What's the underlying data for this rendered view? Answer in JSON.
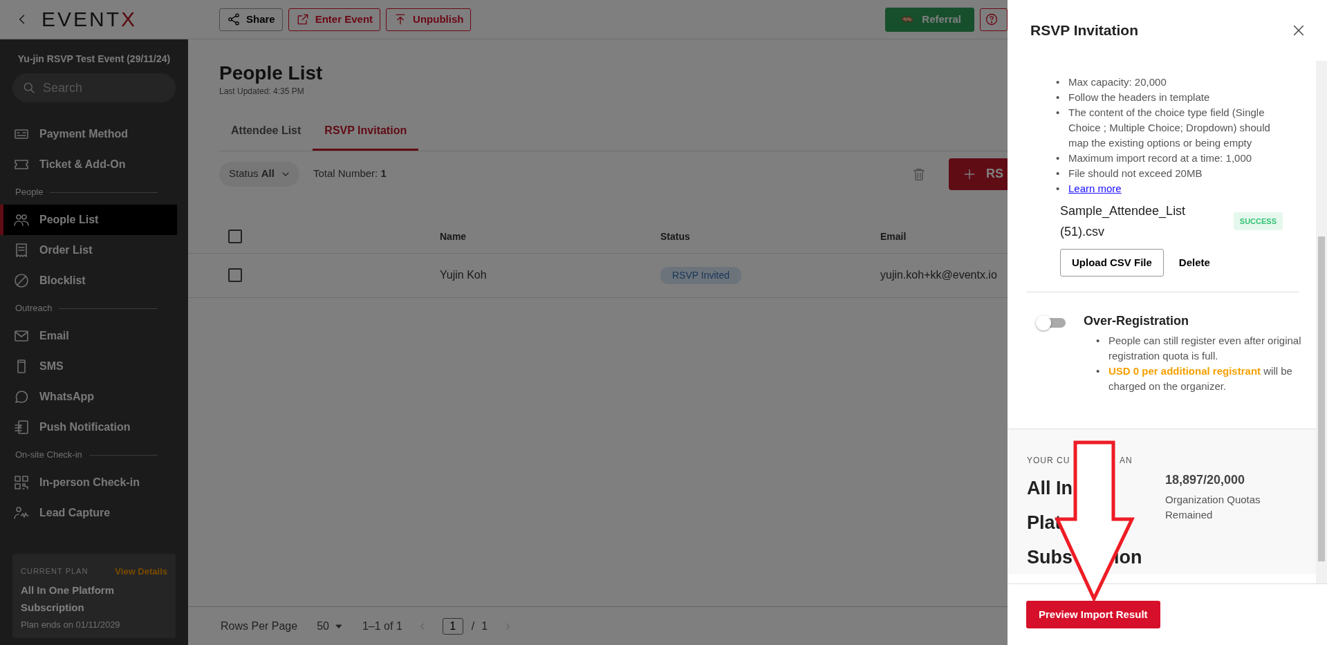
{
  "topbar": {
    "logo": "EVENTX",
    "buttons": [
      {
        "kind": "share",
        "label": "Share"
      },
      {
        "kind": "enter",
        "label": "Enter Event"
      },
      {
        "kind": "unpublish",
        "label": "Unpublish"
      },
      {
        "kind": "referral",
        "label": "Referral"
      },
      {
        "kind": "help"
      }
    ]
  },
  "sidebar": {
    "event_title": "Yu-jin RSVP Test Event (29/11/24)",
    "search_placeholder": "Search",
    "items": [
      {
        "kind": "item",
        "label": "Payment Method",
        "selected": false
      },
      {
        "kind": "item",
        "label": "Ticket & Add-On",
        "selected": false
      },
      {
        "kind": "section",
        "label": "People"
      },
      {
        "kind": "item",
        "label": "People List",
        "selected": true
      },
      {
        "kind": "item",
        "label": "Order List",
        "selected": false
      },
      {
        "kind": "item",
        "label": "Blocklist",
        "selected": false
      },
      {
        "kind": "section",
        "label": "Outreach"
      },
      {
        "kind": "item",
        "label": "Email",
        "selected": false
      },
      {
        "kind": "item",
        "label": "SMS",
        "selected": false
      },
      {
        "kind": "item",
        "label": "WhatsApp",
        "selected": false
      },
      {
        "kind": "item",
        "label": "Push Notification",
        "selected": false
      },
      {
        "kind": "section",
        "label": "On-site Check-in"
      },
      {
        "kind": "item",
        "label": "In-person Check-in",
        "selected": false
      },
      {
        "kind": "item",
        "label": "Lead Capture",
        "selected": false
      }
    ],
    "plan": {
      "label": "CURRENT PLAN",
      "link": "View Details",
      "name": "All In One Platform Subscription",
      "ends": "Plan ends on 01/11/2029"
    }
  },
  "page": {
    "title": "People List",
    "last_updated": "Last Updated: 4:35 PM",
    "tabs": [
      {
        "label": "Attendee List",
        "selected": false
      },
      {
        "label": "RSVP Invitation",
        "selected": true
      }
    ],
    "filter": {
      "label": "Status",
      "value": "All"
    },
    "total": {
      "label": "Total Number:",
      "value": "1"
    },
    "add_button": "RS",
    "table": {
      "header_checked": false,
      "columns": [
        "Name",
        "Status",
        "Email"
      ],
      "rows": [
        {
          "checked": false,
          "name": "Yujin Koh",
          "status": "RSVP Invited",
          "email": "yujin.koh+kk@eventx.io"
        }
      ]
    },
    "pagination": {
      "rows_label": "Rows Per Page",
      "rows_value": "50",
      "range": "1–1 of 1",
      "page": "1",
      "separator": "/",
      "pages": "1"
    }
  },
  "drawer": {
    "title": "RSVP Invitation",
    "rules": [
      {
        "kind": "text",
        "bullet": "•",
        "text": "Max capacity: 20,000"
      },
      {
        "kind": "text",
        "bullet": "•",
        "text": "Follow the headers in template"
      },
      {
        "kind": "text",
        "bullet": "•",
        "text": "The content of the choice type field (Single Choice ; Multiple Choice; Dropdown) should map the existing options or being empty"
      },
      {
        "kind": "text",
        "bullet": "•",
        "text": "Maximum import record at a time: 1,000"
      },
      {
        "kind": "text",
        "bullet": "•",
        "text": "File should not exceed 20MB"
      },
      {
        "kind": "link",
        "bullet": "•",
        "text": "Learn more"
      }
    ],
    "file": {
      "name": "Sample_Attendee_List (51).csv",
      "status": "SUCCESS"
    },
    "file_buttons": [
      "Upload CSV File",
      "Delete"
    ],
    "over_registration": {
      "title": "Over-Registration",
      "on": false,
      "notes": [
        {
          "bullet": "•",
          "text": "People can still register even after original registration quota is full."
        },
        {
          "bullet": "•",
          "text": "**USD 0 per additional registrant** will be charged on the organizer."
        }
      ]
    },
    "plan": {
      "label": {
        "left": "YOUR CU",
        "right": "AN"
      },
      "name_lines": [
        {
          "left": "All In"
        },
        {
          "left": "Plat"
        },
        {
          "left": "Subs",
          "right": "ion"
        }
      ],
      "quota": "18,897/20,000",
      "quota_label": "Organization Quotas Remained"
    },
    "primary_button": "Preview Import Result"
  }
}
